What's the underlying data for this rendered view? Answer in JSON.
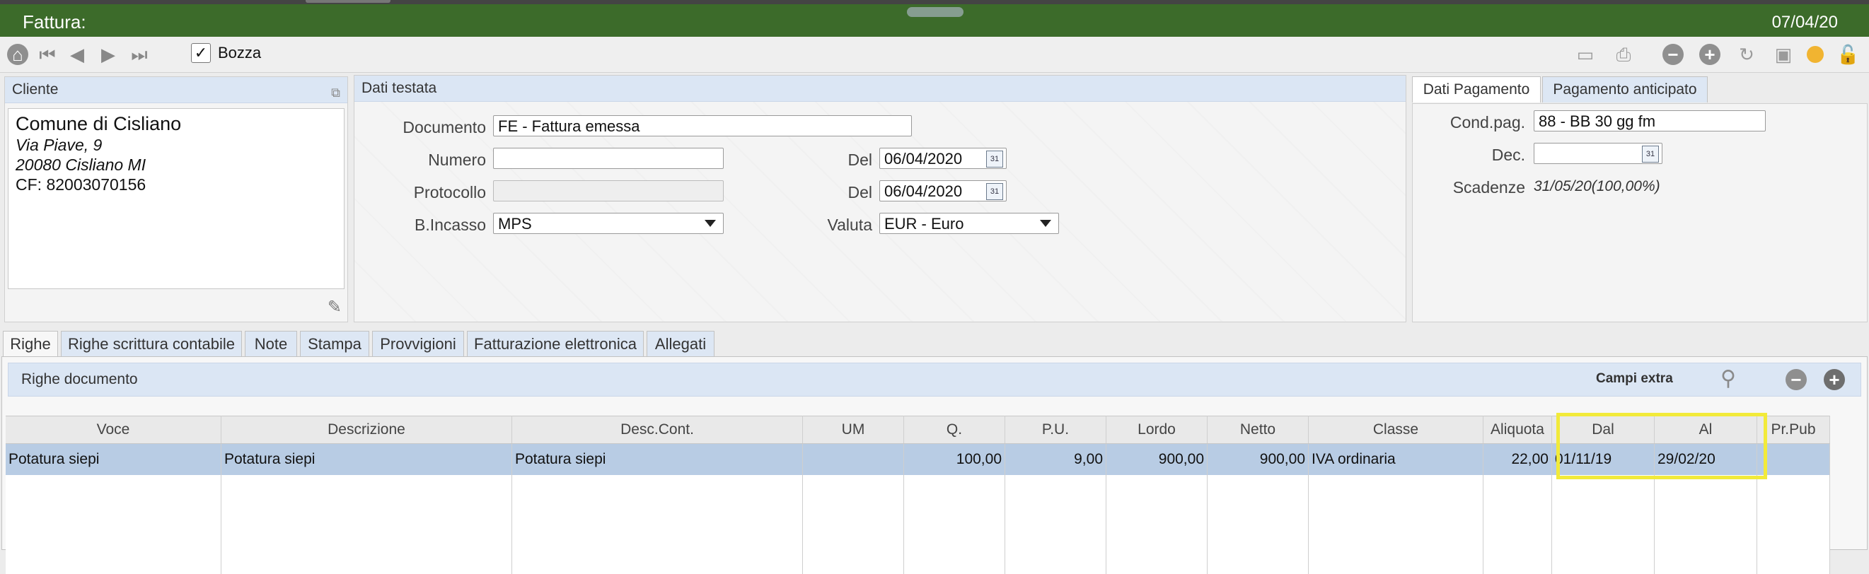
{
  "window": {
    "title": "Fattura:",
    "date": "07/04/20"
  },
  "toolbar": {
    "draft_label": "Bozza",
    "draft_checked": true
  },
  "cliente": {
    "header": "Cliente",
    "name": "Comune di Cisliano",
    "address1": "Via Piave, 9",
    "address2": "20080 Cisliano  MI",
    "cf": "CF: 82003070156"
  },
  "testata": {
    "header": "Dati testata",
    "documento_label": "Documento",
    "documento_value": "FE - Fattura emessa",
    "numero_label": "Numero",
    "numero_value": "",
    "del1_label": "Del",
    "del1_value": "06/04/2020",
    "protocollo_label": "Protocollo",
    "protocollo_value": "",
    "del2_label": "Del",
    "del2_value": "06/04/2020",
    "bincasso_label": "B.Incasso",
    "bincasso_value": "MPS",
    "valuta_label": "Valuta",
    "valuta_value": "EUR - Euro",
    "watermark": "DRAFT"
  },
  "pagamento": {
    "tabs": [
      "Dati Pagamento",
      "Pagamento anticipato"
    ],
    "cond_label": "Cond.pag.",
    "cond_value": "88 - BB 30 gg fm",
    "dec_label": "Dec.",
    "dec_value": "",
    "scadenze_label": "Scadenze",
    "scadenze_value": "31/05/20(100,00%)"
  },
  "tabs": [
    "Righe",
    "Righe scrittura contabile",
    "Note",
    "Stampa",
    "Provvigioni",
    "Fatturazione elettronica",
    "Allegati"
  ],
  "righe": {
    "header": "Righe documento",
    "campi_extra": "Campi extra",
    "columns": [
      "Voce",
      "Descrizione",
      "Desc.Cont.",
      "UM",
      "Q.",
      "P.U.",
      "Lordo",
      "Netto",
      "Classe",
      "Aliquota",
      "Dal",
      "Al",
      "Pr.Pub"
    ],
    "rows": [
      [
        "Potatura siepi",
        "Potatura siepi",
        "Potatura siepi",
        "",
        "100,00",
        "9,00",
        "900,00",
        "900,00",
        "IVA ordinaria",
        "22,00",
        "01/11/19",
        "29/02/20",
        ""
      ]
    ]
  },
  "colors": {
    "titlebar": "#3c6b2a",
    "highlight": "#f2ea3a",
    "selected_row": "#b8cce4"
  }
}
